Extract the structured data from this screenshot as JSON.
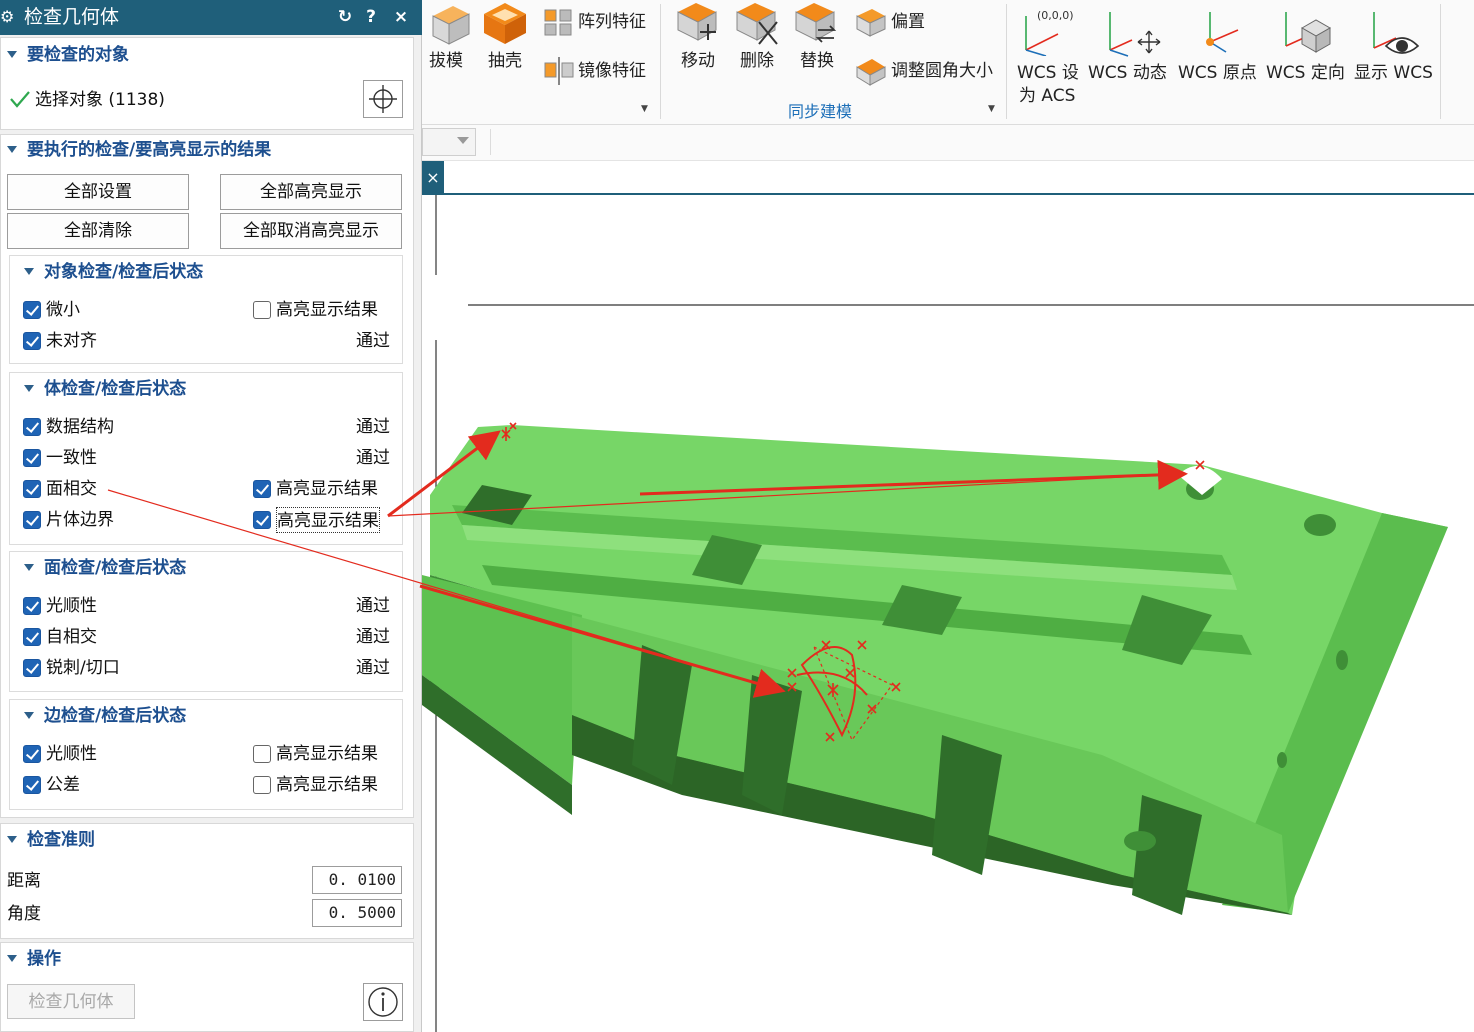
{
  "dialog": {
    "title": "检查几何体",
    "gear_icon": "gear-icon",
    "reset_icon": "reset-icon",
    "help_label": "?",
    "close_label": "×"
  },
  "objects_section": {
    "title": "要检查的对象",
    "select_label": "选择对象 (1138)",
    "check_icon": "checkmark-icon",
    "target_icon": "crosshair-icon"
  },
  "checks_section": {
    "title": "要执行的检查/要高亮显示的结果",
    "buttons": {
      "set_all": "全部设置",
      "highlight_all": "全部高亮显示",
      "clear_all": "全部清除",
      "unhighlight_all": "全部取消高亮显示"
    },
    "object_checks": {
      "title": "对象检查/检查后状态",
      "rows": [
        {
          "label": "微小",
          "checked": true,
          "status": "",
          "highlight": false,
          "highlight_label": "高亮显示结果"
        },
        {
          "label": "未对齐",
          "checked": true,
          "status": "通过"
        }
      ]
    },
    "body_checks": {
      "title": "体检查/检查后状态",
      "rows": [
        {
          "label": "数据结构",
          "checked": true,
          "status": "通过"
        },
        {
          "label": "一致性",
          "checked": true,
          "status": "通过"
        },
        {
          "label": "面相交",
          "checked": true,
          "highlight": true,
          "highlight_label": "高亮显示结果"
        },
        {
          "label": "片体边界",
          "checked": true,
          "highlight": true,
          "highlight_label": "高亮显示结果"
        }
      ]
    },
    "face_checks": {
      "title": "面检查/检查后状态",
      "rows": [
        {
          "label": "光顺性",
          "checked": true,
          "status": "通过"
        },
        {
          "label": "自相交",
          "checked": true,
          "status": "通过"
        },
        {
          "label": "锐刺/切口",
          "checked": true,
          "status": "通过"
        }
      ]
    },
    "edge_checks": {
      "title": "边检查/检查后状态",
      "rows": [
        {
          "label": "光顺性",
          "checked": true,
          "highlight": false,
          "highlight_label": "高亮显示结果"
        },
        {
          "label": "公差",
          "checked": true,
          "highlight": false,
          "highlight_label": "高亮显示结果"
        }
      ]
    }
  },
  "criteria_section": {
    "title": "检查准则",
    "distance_label": "距离",
    "distance_value": "0. 0100",
    "angle_label": "角度",
    "angle_value": "0. 5000"
  },
  "operation_section": {
    "title": "操作",
    "check_button": "检查几何体",
    "info_icon": "info-icon"
  },
  "ribbon": {
    "draft": "拔模",
    "shell": "抽壳",
    "pattern_feature": "阵列特征",
    "mirror_feature": "镜像特征",
    "move": "移动",
    "delete": "删除",
    "replace": "替换",
    "offset": "偏置",
    "resize_blend": "调整圆角大小",
    "sync_group": "同步建模",
    "wcs_set_acs_1": "WCS 设",
    "wcs_set_acs_2": "为 ACS",
    "wcs_origin_text": "(0,0,0)",
    "wcs_dynamic": "WCS 动态",
    "wcs_origin": "WCS 原点",
    "wcs_orient": "WCS 定向",
    "show_wcs": "显示 WCS"
  },
  "viewport": {
    "tab_close": "×",
    "model_color": "#6ccf5c",
    "model_dark": "#2f6e2a",
    "marker_color": "#e32b1e"
  }
}
